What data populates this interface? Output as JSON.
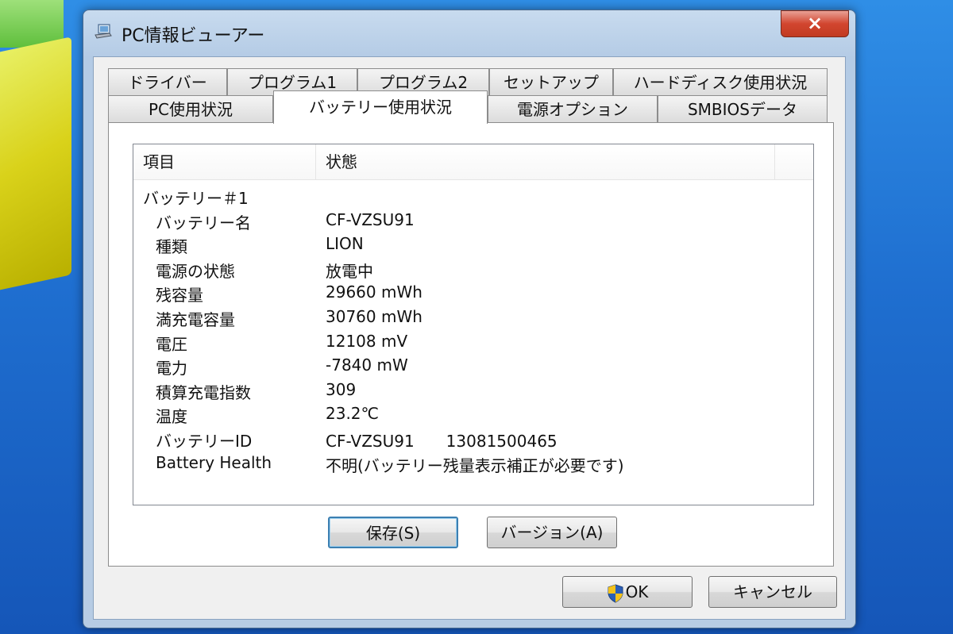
{
  "window": {
    "title": "PC情報ビューアー",
    "close_label": "×"
  },
  "tabs": {
    "back_row": [
      "ドライバー",
      "プログラム1",
      "プログラム2",
      "セットアップ",
      "ハードディスク使用状況"
    ],
    "front_row": [
      "PC使用状況",
      "バッテリー使用状況",
      "電源オプション",
      "SMBIOSデータ"
    ],
    "active": "バッテリー使用状況"
  },
  "list": {
    "columns": [
      "項目",
      "状態"
    ],
    "group": "バッテリー＃1",
    "rows": [
      {
        "key": "バッテリー名",
        "value": "CF-VZSU91"
      },
      {
        "key": "種類",
        "value": "LION"
      },
      {
        "key": "電源の状態",
        "value": "放電中"
      },
      {
        "key": "残容量",
        "value": "29660 mWh"
      },
      {
        "key": "満充電容量",
        "value": "30760 mWh"
      },
      {
        "key": "電圧",
        "value": "12108 mV"
      },
      {
        "key": "電力",
        "value": "-7840 mW"
      },
      {
        "key": "積算充電指数",
        "value": "309"
      },
      {
        "key": "温度",
        "value": "23.2℃"
      },
      {
        "key": "バッテリーID",
        "value": "CF-VZSU91　　13081500465"
      },
      {
        "key": "Battery Health",
        "value": "不明(バッテリー残量表示補正が必要です)"
      }
    ]
  },
  "buttons": {
    "save": "保存(S)",
    "version": "バージョン(A)",
    "ok": "OK",
    "cancel": "キャンセル"
  },
  "icons": {
    "app": "laptop-icon",
    "uac": "uac-shield-icon"
  }
}
